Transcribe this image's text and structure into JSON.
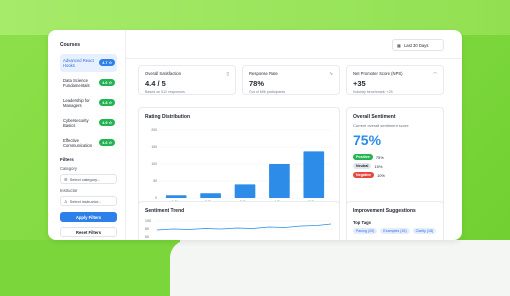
{
  "sidebar": {
    "courses_heading": "Courses",
    "courses": [
      {
        "name": "Advanced React Hooks",
        "rating": "4.7 ☆",
        "active": true,
        "color": "#2d7fea"
      },
      {
        "name": "Data Science Fundamentals",
        "rating": "4.6 ☆",
        "active": false,
        "color": "#22b352"
      },
      {
        "name": "Leadership for Managers",
        "rating": "4.8 ☆",
        "active": false,
        "color": "#22b352"
      },
      {
        "name": "Cybersecurity Basics",
        "rating": "4.9 ☆",
        "active": false,
        "color": "#22b352"
      },
      {
        "name": "Effective Communication",
        "rating": "4.6 ☆",
        "active": false,
        "color": "#22b352"
      }
    ],
    "filters_heading": "Filters",
    "category_label": "Category",
    "category_placeholder": "Select category...",
    "instructor_label": "Instructor",
    "instructor_placeholder": "Select instructor...",
    "apply_label": "Apply Filters",
    "reset_label": "Reset Filters"
  },
  "header": {
    "date_range": "Last 30 Days"
  },
  "kpis": [
    {
      "title": "Overall Satisfaction",
      "value": "4.4 / 5",
      "sub": "Based on 512 responses",
      "icon": "▯"
    },
    {
      "title": "Response Rate",
      "value": "78%",
      "sub": "Out of 656 participants",
      "icon": "∿"
    },
    {
      "title": "Net Promoter Score (NPS)",
      "value": "+35",
      "sub": "Industry benchmark: +25",
      "icon": "◠"
    }
  ],
  "rating_distribution": {
    "title": "Rating Distribution"
  },
  "chart_data": {
    "type": "bar",
    "categories": [
      "1 Star",
      "2 Stars",
      "3 Stars",
      "4 Stars",
      "5 Stars"
    ],
    "values": [
      8,
      14,
      40,
      100,
      137
    ],
    "ylim": [
      0,
      200
    ],
    "yticks": [
      0,
      50,
      100,
      150,
      200
    ],
    "color": "#2d8ce8"
  },
  "sentiment": {
    "title": "Overall Sentiment",
    "subtitle": "Current overall sentiment score",
    "score": "75%",
    "rows": [
      {
        "label": "Positive",
        "value": "75%",
        "color": "#22b352"
      },
      {
        "label": "Neutral",
        "value": "15%",
        "color": "#e2e5ea"
      },
      {
        "label": "Negative",
        "value": "10%",
        "color": "#e5483f"
      }
    ]
  },
  "trend": {
    "title": "Sentiment Trend",
    "y_ticks": [
      "100",
      "80",
      "60"
    ]
  },
  "suggestions": {
    "title": "Improvement Suggestions",
    "top_tags_label": "Top Tags",
    "tags": [
      "Pacing (20)",
      "Examples (15)",
      "Clarity (18)"
    ]
  }
}
